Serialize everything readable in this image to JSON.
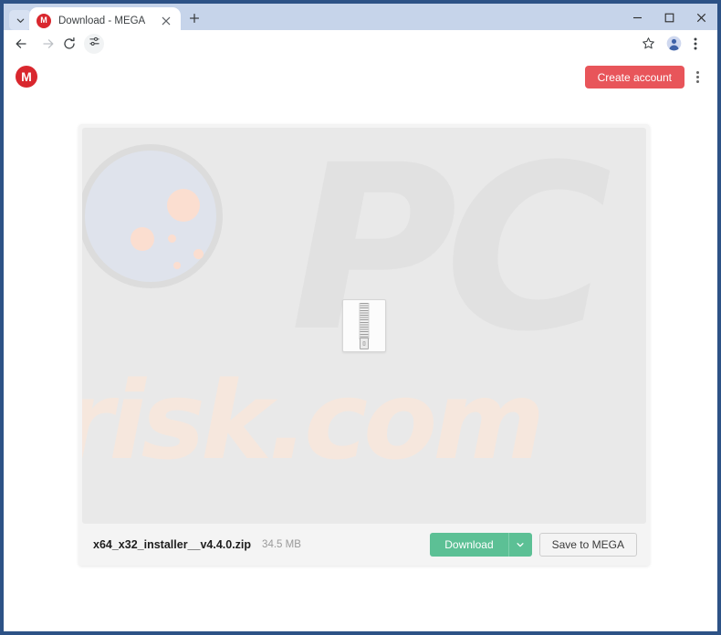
{
  "browser": {
    "tab_list_icon": "chevron-down-icon",
    "tab": {
      "favicon_letter": "M",
      "title": "Download - MEGA",
      "close_icon": "close-icon"
    },
    "new_tab_icon": "plus-icon",
    "window_controls": {
      "minimize": "minimize-icon",
      "maximize": "maximize-icon",
      "close": "close-icon"
    },
    "toolbar": {
      "back_icon": "arrow-left-icon",
      "forward_icon": "arrow-right-icon",
      "reload_icon": "reload-icon",
      "tune_icon": "sliders-icon",
      "bookmark_icon": "star-icon",
      "profile_icon": "person-icon",
      "menu_icon": "kebab-menu-icon"
    }
  },
  "site": {
    "logo_letter": "M",
    "create_account_label": "Create account",
    "menu_icon": "kebab-menu-icon"
  },
  "file": {
    "name": "x64_x32_installer__v4.4.0.zip",
    "size": "34.5 MB",
    "preview_icon": "zip-file-icon",
    "download_label": "Download",
    "download_caret_icon": "chevron-down-icon",
    "save_to_mega_label": "Save to MEGA"
  },
  "watermark": {
    "big_text": "PC",
    "sub_text": "risk.com",
    "glass_icon": "magnifying-glass-icon"
  },
  "colors": {
    "window_frame": "#2d5286",
    "tabstrip": "#c6d4ea",
    "mega_red": "#d9272e",
    "create_account_bg": "#e8555a",
    "download_green": "#5cc095",
    "preview_bg": "#e9e9e9",
    "watermark_gray": "#e1e1e1",
    "watermark_peach": "#f6e7dd"
  }
}
